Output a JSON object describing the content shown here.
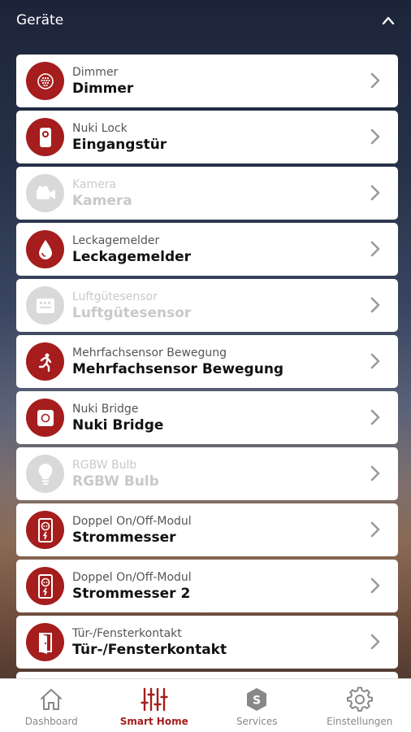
{
  "header": {
    "title": "Geräte"
  },
  "devices": [
    {
      "type": "Dimmer",
      "name": "Dimmer",
      "icon": "dimmer-icon",
      "enabled": true
    },
    {
      "type": "Nuki Lock",
      "name": "Eingangstür",
      "icon": "lock-icon",
      "enabled": true
    },
    {
      "type": "Kamera",
      "name": "Kamera",
      "icon": "camera-icon",
      "enabled": false
    },
    {
      "type": "Leckagemelder",
      "name": "Leckagemelder",
      "icon": "water-drop-icon",
      "enabled": true
    },
    {
      "type": "Luftgütesensor",
      "name": "Luftgütesensor",
      "icon": "air-sensor-icon",
      "enabled": false
    },
    {
      "type": "Mehrfachsensor Bewegung",
      "name": "Mehrfachsensor Bewegung",
      "icon": "motion-icon",
      "enabled": true
    },
    {
      "type": "Nuki Bridge",
      "name": "Nuki Bridge",
      "icon": "bridge-icon",
      "enabled": true
    },
    {
      "type": "RGBW Bulb",
      "name": "RGBW Bulb",
      "icon": "bulb-icon",
      "enabled": false
    },
    {
      "type": "Doppel On/Off-Modul",
      "name": "Strommesser",
      "icon": "outlet-icon",
      "enabled": true
    },
    {
      "type": "Doppel On/Off-Modul",
      "name": "Strommesser 2",
      "icon": "outlet-icon",
      "enabled": true
    },
    {
      "type": "Tür-/Fensterkontakt",
      "name": "Tür-/Fensterkontakt",
      "icon": "door-icon",
      "enabled": true
    }
  ],
  "tabs": [
    {
      "label": "Dashboard",
      "icon": "home-icon",
      "active": false
    },
    {
      "label": "Smart Home",
      "icon": "sliders-icon",
      "active": true
    },
    {
      "label": "Services",
      "icon": "services-icon",
      "active": false
    },
    {
      "label": "Einstellungen",
      "icon": "gear-icon",
      "active": false
    }
  ],
  "colors": {
    "accent": "#a51d1d",
    "disabled": "#d9d9d9"
  }
}
